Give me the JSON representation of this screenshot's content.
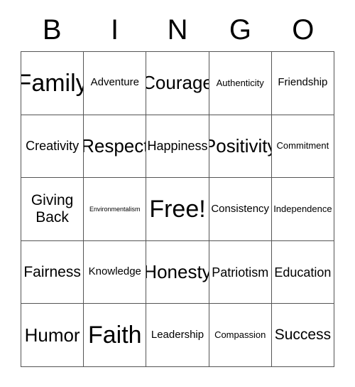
{
  "card": {
    "title": "BINGO",
    "background_color": "#ffffff",
    "grid_line_color": "#555555",
    "text_color": "#000000"
  },
  "header": {
    "letters": [
      {
        "label": "B"
      },
      {
        "label": "I"
      },
      {
        "label": "N"
      },
      {
        "label": "G"
      },
      {
        "label": "O"
      }
    ]
  },
  "grid": {
    "columns": 5,
    "rows": 5,
    "cells": [
      {
        "label": "Family",
        "size": "fs-xxl",
        "free": false
      },
      {
        "label": "Adventure",
        "size": "fs-sm",
        "free": false
      },
      {
        "label": "Courage",
        "size": "fs-xl",
        "free": false
      },
      {
        "label": "Authenticity",
        "size": "fs-xs",
        "free": false
      },
      {
        "label": "Friendship",
        "size": "fs-sm",
        "free": false
      },
      {
        "label": "Creativity",
        "size": "fs-md",
        "free": false
      },
      {
        "label": "Respect",
        "size": "fs-xl",
        "free": false
      },
      {
        "label": "Happiness",
        "size": "fs-md",
        "free": false
      },
      {
        "label": "Positivity",
        "size": "fs-xl",
        "free": false
      },
      {
        "label": "Commitment",
        "size": "fs-xs",
        "free": false
      },
      {
        "label": "Giving\nBack",
        "size": "fs-lg",
        "free": false
      },
      {
        "label": "Environmentalism",
        "size": "fs-xxs",
        "free": false
      },
      {
        "label": "Free!",
        "size": "fs-xxl",
        "free": true
      },
      {
        "label": "Consistency",
        "size": "fs-sm",
        "free": false
      },
      {
        "label": "Independence",
        "size": "fs-xs",
        "free": false
      },
      {
        "label": "Fairness",
        "size": "fs-lg",
        "free": false
      },
      {
        "label": "Knowledge",
        "size": "fs-sm",
        "free": false
      },
      {
        "label": "Honesty",
        "size": "fs-xl",
        "free": false
      },
      {
        "label": "Patriotism",
        "size": "fs-md",
        "free": false
      },
      {
        "label": "Education",
        "size": "fs-md",
        "free": false
      },
      {
        "label": "Humor",
        "size": "fs-xl",
        "free": false
      },
      {
        "label": "Faith",
        "size": "fs-xxl",
        "free": false
      },
      {
        "label": "Leadership",
        "size": "fs-sm",
        "free": false
      },
      {
        "label": "Compassion",
        "size": "fs-xs",
        "free": false
      },
      {
        "label": "Success",
        "size": "fs-lg",
        "free": false
      }
    ]
  }
}
